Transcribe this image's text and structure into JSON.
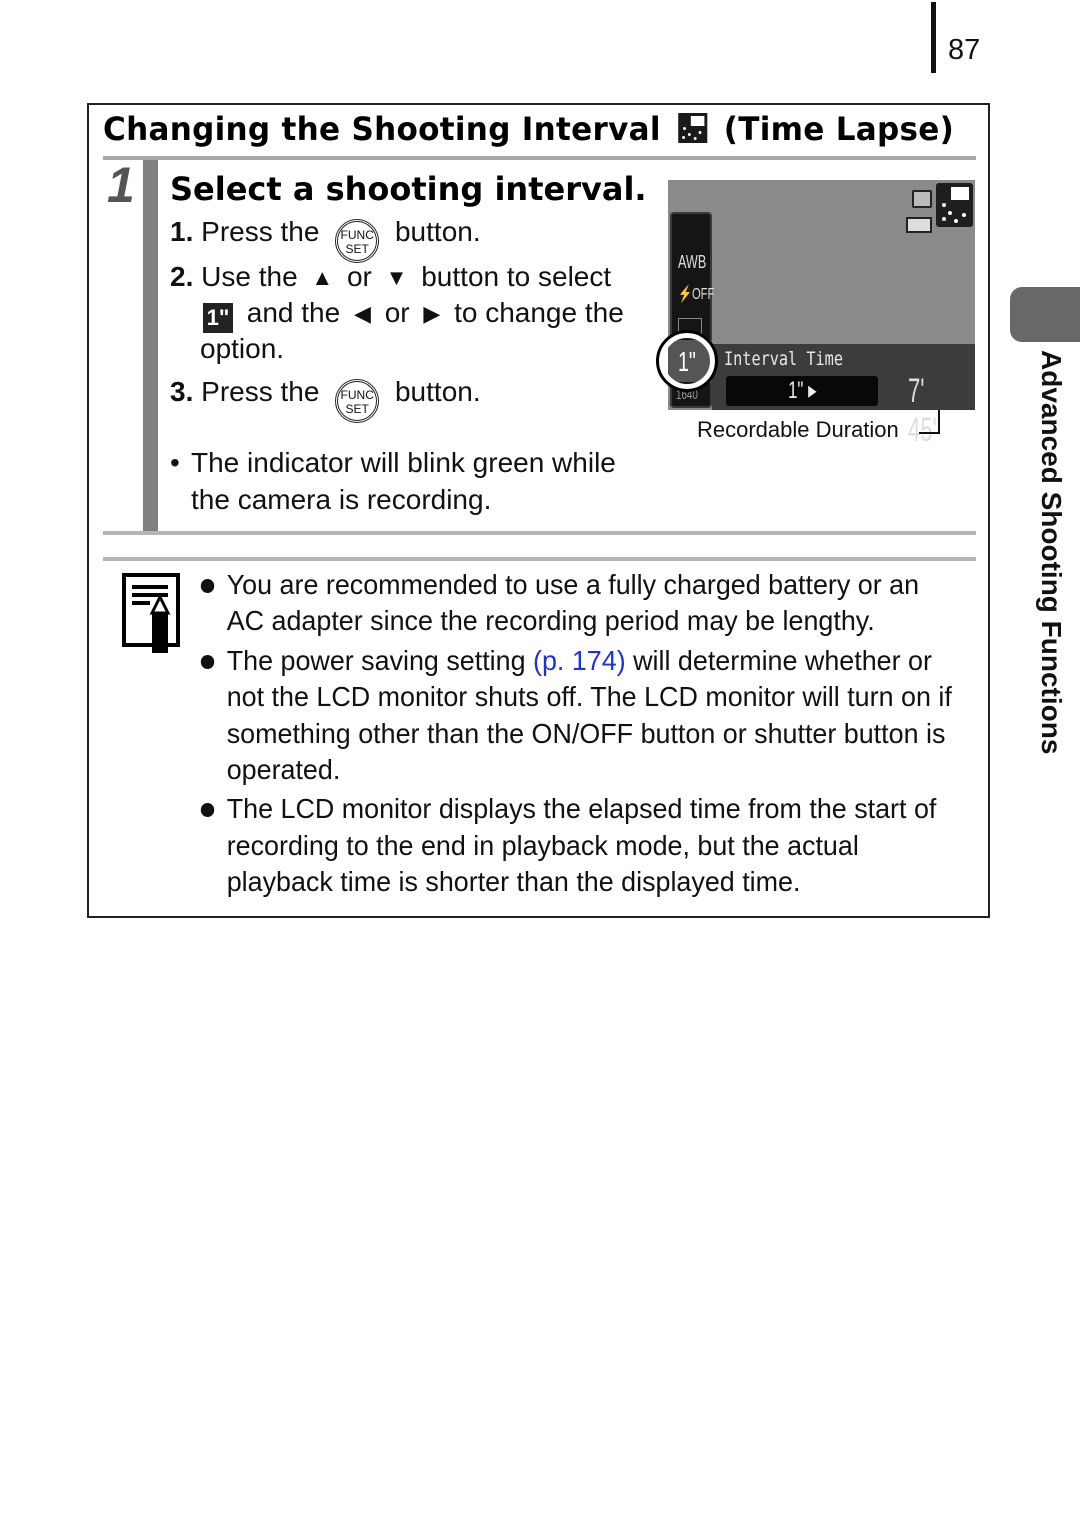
{
  "page_number": "87",
  "section": {
    "title_prefix": "Changing the Shooting Interval",
    "title_icon": "time-lapse-mode-icon",
    "title_suffix": "(Time Lapse)"
  },
  "step": {
    "number": "1",
    "heading": "Select a shooting interval.",
    "instructions": [
      {
        "num": "1.",
        "before": "Press the",
        "icon": "func-set-button-icon",
        "icon_text_top": "FUNC",
        "icon_text_bottom": "SET",
        "after": "button."
      },
      {
        "num": "2.",
        "line1_before": "Use the",
        "up_arrow": "▲",
        "or1": "or",
        "down_arrow": "▼",
        "line1_after": "button to select",
        "line2_icon_text": "1\"",
        "line2_mid": "and the",
        "left_arrow": "◀",
        "or2": "or",
        "right_arrow": "▶",
        "line2_after": "to change the",
        "line3": "option."
      },
      {
        "num": "3.",
        "before": "Press the",
        "icon": "func-set-button-icon",
        "icon_text_top": "FUNC",
        "icon_text_bottom": "SET",
        "after": "button."
      }
    ],
    "note_bullet": "•",
    "note": "The indicator will blink green while the camera is recording."
  },
  "lcd": {
    "side_items": [
      "AWB",
      "⚡OFF",
      "1640"
    ],
    "selected_item": "1\"",
    "label": "Interval Time",
    "value": "1\" ▸",
    "duration": "7' 45\"",
    "caption": "Recordable Duration"
  },
  "info": {
    "icon": "memo-pencil-icon",
    "items": [
      {
        "text": "You are recommended to use a fully charged battery or an AC adapter since the recording period may be lengthy."
      },
      {
        "before": "The power saving setting ",
        "link": "(p. 174)",
        "after": " will determine whether or not the LCD monitor shuts off. The LCD monitor will turn on if something other than the ON/OFF button or shutter button is operated."
      },
      {
        "text": "The LCD monitor displays the elapsed time from the start of recording to the end in playback mode, but the actual playback time is shorter than the displayed time."
      }
    ]
  },
  "side_tab": {
    "label": "Advanced Shooting Functions"
  },
  "colors": {
    "link": "#1a32d8",
    "step_bar": "#808080",
    "tab": "#686868"
  }
}
